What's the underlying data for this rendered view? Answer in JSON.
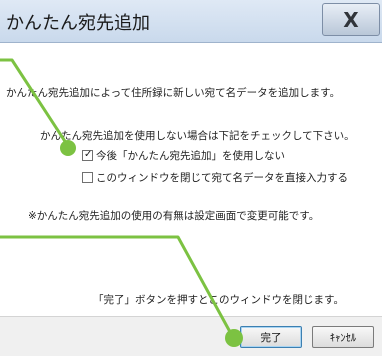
{
  "window": {
    "title": "かんたん宛先追加",
    "close_glyph": "X"
  },
  "body": {
    "intro": "かんたん宛先追加によって住所録に新しい宛て名データを追加します。",
    "instruction": "かんたん宛先追加を使用しない場合は下記をチェックして下さい。",
    "option_disable": {
      "label": "今後「かんたん宛先追加」を使用しない",
      "checked": true
    },
    "option_direct": {
      "label": "このウィンドウを閉じて宛て名データを直接入力する",
      "checked": false
    },
    "note": "※かんたん宛先追加の使用の有無は設定画面で変更可能です。",
    "footer_hint": "「完了」ボタンを押すとこのウィンドウを閉じます。"
  },
  "buttons": {
    "finish": "完了",
    "cancel": "ｷｬﾝｾﾙ"
  },
  "callout": {
    "color": "#7cc242"
  }
}
